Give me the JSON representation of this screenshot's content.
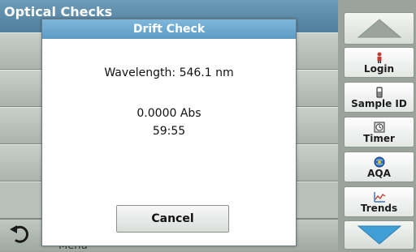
{
  "background": {
    "title": "Optical Checks",
    "bottom_menu_label": "Menu"
  },
  "dialog": {
    "title": "Drift Check",
    "wavelength": "Wavelength: 546.1 nm",
    "absorbance": "0.0000 Abs",
    "timer": "59:55",
    "cancel_label": "Cancel"
  },
  "sidebar": {
    "login_label": "Login",
    "sample_id_label": "Sample ID",
    "timer_label": "Timer",
    "aqa_label": "AQA",
    "trends_label": "Trends"
  },
  "colors": {
    "title_bar": "#5b8cab",
    "dialog_title": "#6aa8d0",
    "scroll_arrow_up": "#9aa39c",
    "scroll_arrow_down": "#3f9fd6"
  }
}
